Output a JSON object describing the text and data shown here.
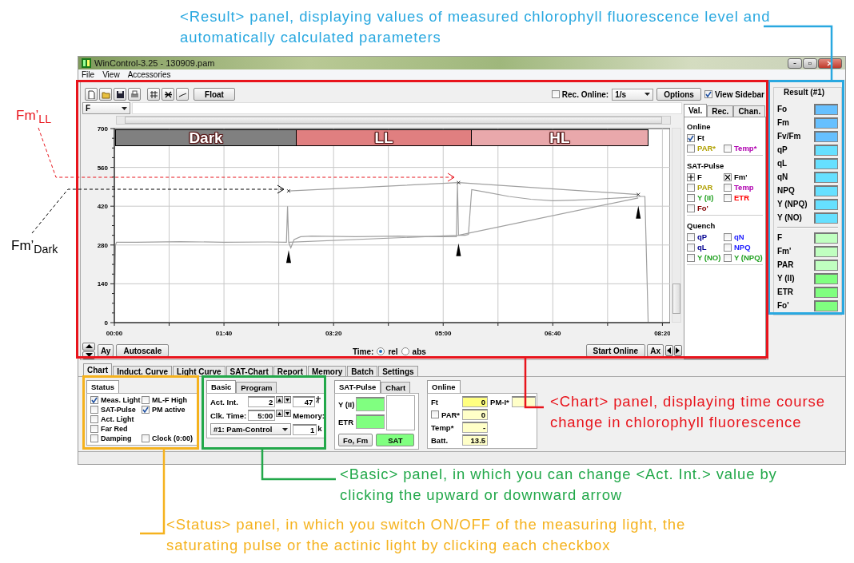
{
  "callouts": [
    {
      "kind": "result",
      "text": "<Result> panel, displaying values of measured chlorophyll fluorescence level and automatically calculated parameters",
      "color": "#29a8e0"
    },
    {
      "kind": "fm_ll",
      "text": "Fm’$_{LL}$",
      "color": "#e8141c"
    },
    {
      "kind": "fm_dark",
      "text": "Fm’$_{Dark}$",
      "color": "#000000"
    },
    {
      "kind": "chart",
      "text": "<Chart> panel, displaying time course change in chlorophyll fluorescence",
      "color": "#e8141c"
    },
    {
      "kind": "basic",
      "text": "<Basic> panel, in which you can change <Act. Int.> value by clicking the upward or downward arrow",
      "color": "#22a84a"
    },
    {
      "kind": "status",
      "text": "<Status> panel, in which you switch ON/OFF of the measuring light, the saturating pulse or the actinic light by clicking each checkbox",
      "color": "#f5b21e"
    }
  ],
  "window": {
    "title": "WinControl-3.25 - 130909.pam"
  },
  "menu": [
    "File",
    "View",
    "Accessories"
  ],
  "toolbar": {
    "float_button": "Float",
    "rec_online": {
      "label": "Rec. Online:",
      "checked": false
    },
    "interval": "1/s",
    "options_button": "Options",
    "view_sidebar": {
      "label": "View Sidebar",
      "checked": true
    }
  },
  "channel_select": "F",
  "chart": {
    "chart_data": {
      "type": "line",
      "xlim": [
        0,
        507
      ],
      "ylim": [
        0,
        700
      ],
      "yticks": [
        0,
        140,
        280,
        420,
        560,
        700
      ],
      "xticks": [
        {
          "value": 0,
          "label": "00:00"
        },
        {
          "value": 100,
          "label": "01:40"
        },
        {
          "value": 200,
          "label": "03:20"
        },
        {
          "value": 300,
          "label": "05:00"
        },
        {
          "value": 400,
          "label": "06:40"
        },
        {
          "value": 500,
          "label": "08:20"
        }
      ],
      "x": [
        0,
        1,
        2,
        20,
        60,
        100,
        140,
        157,
        158,
        159,
        161,
        164,
        170,
        180,
        220,
        260,
        300,
        312,
        313,
        314,
        316,
        320,
        323,
        326,
        340,
        360,
        380,
        400,
        420,
        440,
        460,
        470,
        478,
        484,
        487
      ],
      "series": [
        {
          "color": "#a0a0a0",
          "marker": "none",
          "values": [
            30,
            280,
            290,
            290,
            292,
            290,
            291,
            290,
            420,
            290,
            270,
            300,
            310,
            312,
            310,
            312,
            310,
            310,
            500,
            315,
            315,
            315,
            318,
            480,
            470,
            455,
            445,
            440,
            442,
            445,
            450,
            452,
            455,
            455,
            0
          ]
        },
        {
          "color": "#a0a0a0",
          "marker": "cross",
          "values": [
            null,
            null,
            null,
            null,
            null,
            null,
            null,
            null,
            null,
            475,
            null,
            null,
            null,
            null,
            null,
            null,
            null,
            null,
            null,
            505,
            null,
            null,
            null,
            null,
            null,
            null,
            null,
            null,
            null,
            null,
            null,
            null,
            462,
            null,
            null
          ]
        },
        {
          "color": "#a0a0a0",
          "values": [
            null,
            null,
            null,
            null,
            null,
            null,
            null,
            null,
            null,
            290,
            null,
            null,
            null,
            null,
            null,
            null,
            null,
            null,
            null,
            315,
            null,
            null,
            null,
            null,
            null,
            null,
            null,
            null,
            null,
            null,
            null,
            null,
            450,
            null,
            null
          ]
        }
      ],
      "grid": true
    },
    "phases": [
      {
        "label": "Dark",
        "color": "#808080"
      },
      {
        "label": "LL",
        "color": "#e07f80"
      },
      {
        "label": "HL",
        "color": "#e9a8ab"
      }
    ]
  },
  "chart_controls": {
    "ay_button": "Ay",
    "autoscale_button": "Autoscale",
    "time_label": "Time:",
    "time_modes": [
      {
        "label": "rel",
        "selected": true
      },
      {
        "label": "abs",
        "selected": false
      }
    ],
    "start_online_button": "Start Online",
    "ax_button": "Ax"
  },
  "sidebar": {
    "tabs": [
      {
        "label": "Val.",
        "selected": true
      },
      {
        "label": "Rec.",
        "selected": false
      },
      {
        "label": "Chan.",
        "selected": false
      }
    ],
    "groups": [
      {
        "title": "Online",
        "rows": [
          [
            {
              "label": "Ft",
              "checked": true,
              "kind": "check",
              "color": "#000000"
            }
          ],
          [
            {
              "label": "PAR*",
              "checked": false,
              "kind": "check",
              "color": "#b0a000"
            },
            {
              "label": "Temp*",
              "checked": false,
              "kind": "check",
              "color": "#b000b0"
            }
          ]
        ]
      },
      {
        "title": "SAT-Pulse",
        "rows": [
          [
            {
              "label": "F",
              "checked": true,
              "kind": "plus",
              "color": "#000000"
            },
            {
              "label": "Fm'",
              "checked": true,
              "kind": "cross",
              "color": "#000000"
            }
          ],
          [
            {
              "label": "PAR",
              "checked": false,
              "kind": "check",
              "color": "#b0a000"
            },
            {
              "label": "Temp",
              "checked": false,
              "kind": "check",
              "color": "#b000b0"
            }
          ],
          [
            {
              "label": "Y (II)",
              "checked": false,
              "kind": "check",
              "color": "#20a020"
            },
            {
              "label": "ETR",
              "checked": false,
              "kind": "check",
              "color": "#ff0000"
            }
          ],
          [
            {
              "label": "Fo'",
              "checked": false,
              "kind": "check",
              "color": "#800000"
            }
          ]
        ]
      },
      {
        "title": "Quench",
        "rows": [
          [
            {
              "label": "qP",
              "checked": false,
              "kind": "check",
              "color": "#000090"
            },
            {
              "label": "qN",
              "checked": false,
              "kind": "check",
              "color": "#2020ff"
            }
          ],
          [
            {
              "label": "qL",
              "checked": false,
              "kind": "check",
              "color": "#000090"
            },
            {
              "label": "NPQ",
              "checked": false,
              "kind": "check",
              "color": "#2020ff"
            }
          ],
          [
            {
              "label": "Y (NO)",
              "checked": false,
              "kind": "check",
              "color": "#20a020"
            },
            {
              "label": "Y (NPQ)",
              "checked": false,
              "kind": "check",
              "color": "#20a020"
            }
          ]
        ]
      }
    ]
  },
  "result": {
    "title": "Result (#1)",
    "groups": [
      [
        {
          "label": "Fo",
          "color": "#66c0ff"
        },
        {
          "label": "Fm",
          "color": "#66c0ff"
        },
        {
          "label": "Fv/Fm",
          "color": "#66c0ff"
        },
        {
          "label": "qP",
          "color": "#66e0ff"
        },
        {
          "label": "qL",
          "color": "#66e0ff"
        },
        {
          "label": "qN",
          "color": "#66e0ff"
        },
        {
          "label": "NPQ",
          "color": "#66e0ff"
        },
        {
          "label": "Y (NPQ)",
          "color": "#66e0ff"
        },
        {
          "label": "Y (NO)",
          "color": "#66e0ff"
        }
      ],
      [
        {
          "label": "F",
          "color": "#c0ffc0"
        },
        {
          "label": "Fm'",
          "color": "#c0ffc0"
        },
        {
          "label": "PAR",
          "color": "#c0ffc0"
        },
        {
          "label": "Y (II)",
          "color": "#80ff80"
        },
        {
          "label": "ETR",
          "color": "#80ff80"
        },
        {
          "label": "Fo'",
          "color": "#80ff80"
        }
      ]
    ]
  },
  "tabs": [
    {
      "label": "Chart",
      "selected": true
    },
    {
      "label": "Induct. Curve",
      "selected": false
    },
    {
      "label": "Light Curve",
      "selected": false
    },
    {
      "label": "SAT-Chart",
      "selected": false
    },
    {
      "label": "Report",
      "selected": false
    },
    {
      "label": "Memory",
      "selected": false
    },
    {
      "label": "Batch",
      "selected": false
    },
    {
      "label": "Settings",
      "selected": false
    }
  ],
  "status_panel": {
    "tab": "Status",
    "rows": [
      [
        {
          "label": "Meas. Light",
          "checked": true
        },
        {
          "label": "ML-F High",
          "checked": false
        }
      ],
      [
        {
          "label": "SAT-Pulse",
          "checked": false
        },
        {
          "label": "PM active",
          "checked": true
        }
      ],
      [
        {
          "label": "Act. Light",
          "checked": false
        }
      ],
      [
        {
          "label": "Far Red",
          "checked": false
        }
      ],
      [
        {
          "label": "Damping",
          "checked": false
        },
        {
          "label": "Clock (0:00)",
          "checked": false
        }
      ]
    ]
  },
  "basic_panel": {
    "tabs": [
      {
        "label": "Basic",
        "selected": true
      },
      {
        "label": "Program",
        "selected": false
      }
    ],
    "act_int": {
      "label": "Act. Int.",
      "value": "2",
      "reading": "47"
    },
    "clk_time": {
      "label": "Clk. Time:",
      "value": "5:00"
    },
    "memory_label": "Memory:",
    "program_select": "#1: Pam-Control",
    "memory_value": "1",
    "memory_unit": "k"
  },
  "sat_panel": {
    "tabs": [
      {
        "label": "SAT-Pulse",
        "selected": true
      },
      {
        "label": "Chart",
        "selected": false
      }
    ],
    "fields": [
      {
        "label": "Y (II)",
        "color": "#80ff80"
      },
      {
        "label": "ETR",
        "color": "#80ff80"
      }
    ],
    "fo_fm_button": "Fo, Fm",
    "sat_button": "SAT"
  },
  "online_panel": {
    "tab": "Online",
    "fields": [
      {
        "kind": "plain",
        "label": "Ft",
        "value": "0",
        "color": "#ffff80"
      },
      {
        "kind": "plain",
        "label": "PM-I*",
        "color": "#ffffc8"
      },
      {
        "kind": "checkbox",
        "label": "PAR*",
        "checked": false,
        "value": "0",
        "color": "#ffffc8"
      },
      {
        "kind": "plain",
        "label": "Temp*",
        "value": "-",
        "color": "#ffffc8"
      },
      {
        "kind": "plain",
        "label": "Batt.",
        "value": "13.5",
        "color": "#ffffc8"
      }
    ]
  }
}
